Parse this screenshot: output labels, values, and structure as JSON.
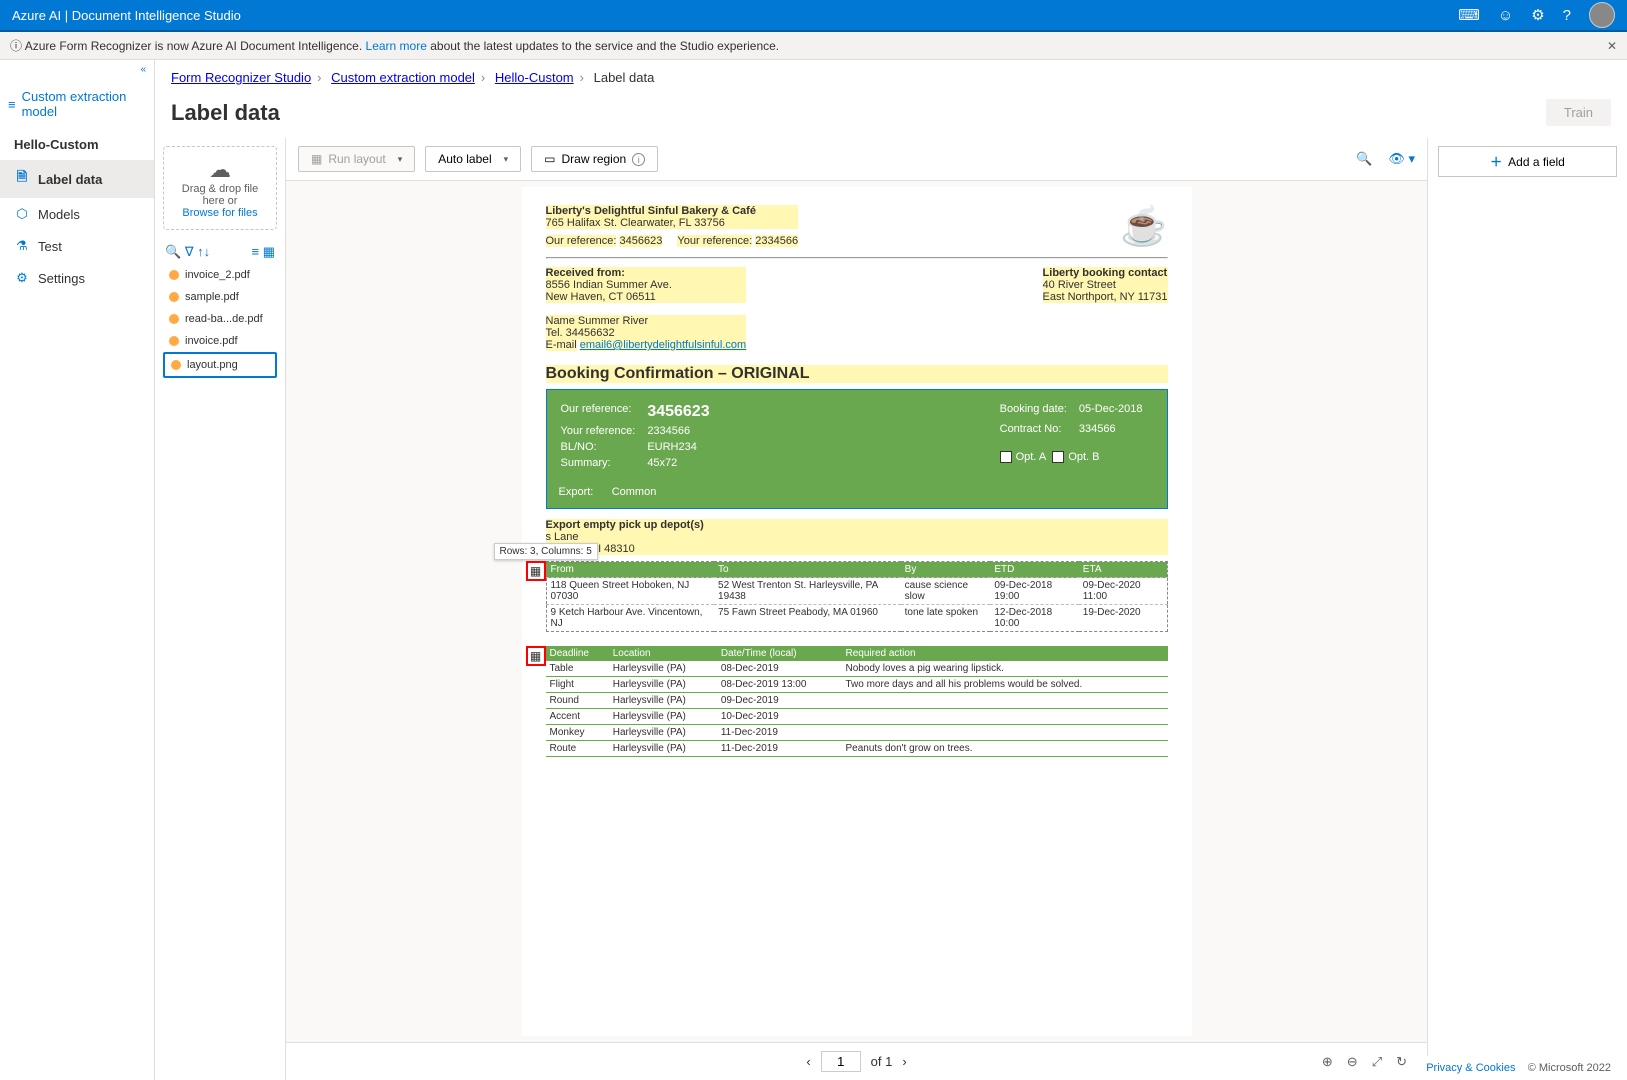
{
  "topbar": {
    "title": "Azure AI | Document Intelligence Studio"
  },
  "banner": {
    "icon": "ⓘ",
    "text_pre": "Azure Form Recognizer is now Azure AI Document Intelligence. ",
    "link": "Learn more",
    "text_post": " about the latest updates to the service and the Studio experience."
  },
  "sidebar": {
    "header": "Custom extraction model",
    "project": "Hello-Custom",
    "items": [
      {
        "icon": "🗎",
        "label": "Label data",
        "active": true
      },
      {
        "icon": "⬡",
        "label": "Models"
      },
      {
        "icon": "⚗",
        "label": "Test"
      },
      {
        "icon": "⚙",
        "label": "Settings"
      }
    ]
  },
  "breadcrumb": [
    "Form Recognizer Studio",
    "Custom extraction model",
    "Hello-Custom",
    "Label data"
  ],
  "page_title": "Label data",
  "train_btn": "Train",
  "dropzone": {
    "line1": "Drag & drop file here or",
    "link": "Browse for files"
  },
  "files": [
    "invoice_2.pdf",
    "sample.pdf",
    "read-ba...de.pdf",
    "invoice.pdf",
    "layout.png"
  ],
  "selected_file_index": 4,
  "toolbar": {
    "run_layout": "Run layout",
    "auto_label": "Auto label",
    "draw_region": "Draw region"
  },
  "right_panel": {
    "add_field": "Add a field"
  },
  "pager": {
    "page": "1",
    "of": "of 1"
  },
  "tooltip": "Rows: 3, Columns: 5",
  "doc": {
    "company": "Liberty's Delightful Sinful Bakery & Café",
    "address": "765 Halifax St. Clearwater, FL 33756",
    "our_ref_lbl": "Our reference:",
    "our_ref": "3456623",
    "your_ref_lbl": "Your reference:",
    "your_ref": "2334566",
    "received_from": "Received from:",
    "rf_addr1": "8556 Indian Summer Ave.",
    "rf_addr2": "New Haven, CT 06511",
    "rf_name": "Name Summer River",
    "rf_tel": "Tel. 34456632",
    "rf_email_lbl": "E-mail",
    "rf_email": "email6@libertydelightfulsinful.com",
    "contact_title": "Liberty booking contact",
    "contact_addr1": "40 River Street",
    "contact_addr2": "East Northport, NY 11731",
    "booking_title": "Booking Confirmation – ORIGINAL",
    "box": {
      "our_ref": "3456623",
      "your_ref": "2334566",
      "blno": "EURH234",
      "summary": "45x72",
      "booking_date": "05-Dec-2018",
      "contract_no": "334566",
      "opt_a": "Opt. A",
      "opt_b": "Opt. B",
      "export_lbl": "Export:",
      "export_val": "Common",
      "our_ref_lbl": "Our reference:",
      "your_ref_lbl": "Your reference:",
      "blno_lbl": "BL/NO:",
      "summary_lbl": "Summary:",
      "booking_date_lbl": "Booking date:",
      "contract_lbl": "Contract No:"
    },
    "depot_title": "Export empty pick up depot(s)",
    "depot_addr1": "s Lane",
    "depot_addr2": "Heights, MI 48310",
    "route_headers": [
      "From",
      "To",
      "By",
      "ETD",
      "ETA"
    ],
    "route_rows": [
      [
        "118 Queen Street Hoboken, NJ 07030",
        "52 West Trenton St. Harleysville, PA 19438",
        "cause science slow",
        "09-Dec-2018 19:00",
        "09-Dec-2020 11:00"
      ],
      [
        "9 Ketch Harbour Ave. Vincentown, NJ",
        "75 Fawn Street Peabody, MA 01960",
        "tone late spoken",
        "12-Dec-2018 10:00",
        "19-Dec-2020"
      ]
    ],
    "deadline_headers": [
      "Deadline",
      "Location",
      "Date/Time (local)",
      "Required action"
    ],
    "deadline_rows": [
      [
        "Table",
        "Harleysville (PA)",
        "08-Dec-2019",
        "Nobody loves a pig wearing lipstick."
      ],
      [
        "Flight",
        "Harleysville (PA)",
        "08-Dec-2019 13:00",
        "Two more days and all his problems would be solved."
      ],
      [
        "Round",
        "Harleysville (PA)",
        "09-Dec-2019",
        ""
      ],
      [
        "Accent",
        "Harleysville (PA)",
        "10-Dec-2019",
        ""
      ],
      [
        "Monkey",
        "Harleysville (PA)",
        "11-Dec-2019",
        ""
      ],
      [
        "Route",
        "Harleysville (PA)",
        "11-Dec-2019",
        "Peanuts don't grow on trees."
      ]
    ]
  },
  "footer": {
    "privacy": "Privacy & Cookies",
    "copyright": "© Microsoft 2022"
  }
}
